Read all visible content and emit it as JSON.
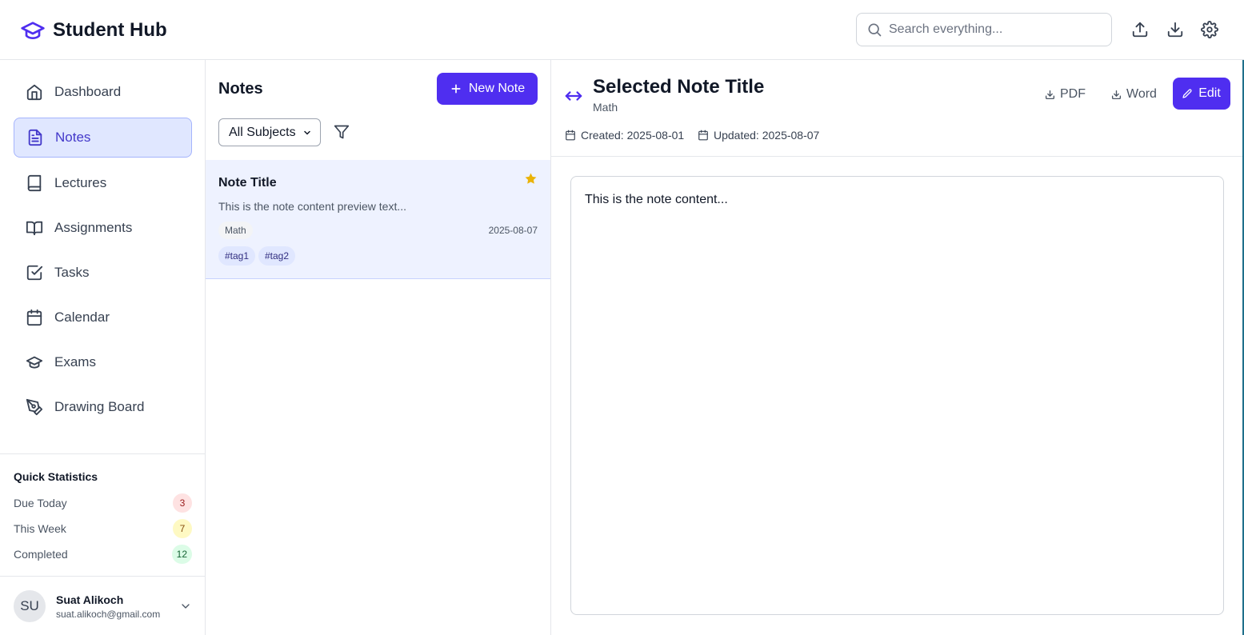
{
  "app": {
    "title": "Student Hub",
    "accent": "#4f2ef0"
  },
  "search": {
    "placeholder": "Search everything..."
  },
  "header_icons": [
    "upload-icon",
    "download-icon",
    "settings-icon"
  ],
  "sidebar": {
    "items": [
      {
        "label": "Dashboard",
        "icon": "home-icon",
        "active": false
      },
      {
        "label": "Notes",
        "icon": "document-icon",
        "active": true
      },
      {
        "label": "Lectures",
        "icon": "book-icon",
        "active": false
      },
      {
        "label": "Assignments",
        "icon": "open-book-icon",
        "active": false
      },
      {
        "label": "Tasks",
        "icon": "checkbox-icon",
        "active": false
      },
      {
        "label": "Calendar",
        "icon": "calendar-icon",
        "active": false
      },
      {
        "label": "Exams",
        "icon": "graduation-cap-icon",
        "active": false
      },
      {
        "label": "Drawing Board",
        "icon": "pen-tool-icon",
        "active": false
      }
    ],
    "stats": {
      "title": "Quick Statistics",
      "rows": [
        {
          "label": "Due Today",
          "value": "3",
          "bg": "#fee2e2",
          "fg": "#991b1b"
        },
        {
          "label": "This Week",
          "value": "7",
          "bg": "#fef9c3",
          "fg": "#854d0e"
        },
        {
          "label": "Completed",
          "value": "12",
          "bg": "#dcfce7",
          "fg": "#166534"
        }
      ]
    },
    "user": {
      "initials": "SU",
      "name": "Suat Alikoch",
      "email": "suat.alikoch@gmail.com"
    }
  },
  "notes": {
    "title": "Notes",
    "new_button": "New Note",
    "filter": {
      "selected": "All Subjects"
    },
    "items": [
      {
        "title": "Note Title",
        "preview": "This is the note content preview text...",
        "subject": "Math",
        "date": "2025-08-07",
        "tags": [
          "#tag1",
          "#tag2"
        ],
        "starred": true
      }
    ]
  },
  "detail": {
    "title": "Selected Note Title",
    "subject": "Math",
    "created": "Created: 2025-08-01",
    "updated": "Updated: 2025-08-07",
    "export_pdf": "PDF",
    "export_word": "Word",
    "edit": "Edit",
    "content": "This is the note content..."
  }
}
